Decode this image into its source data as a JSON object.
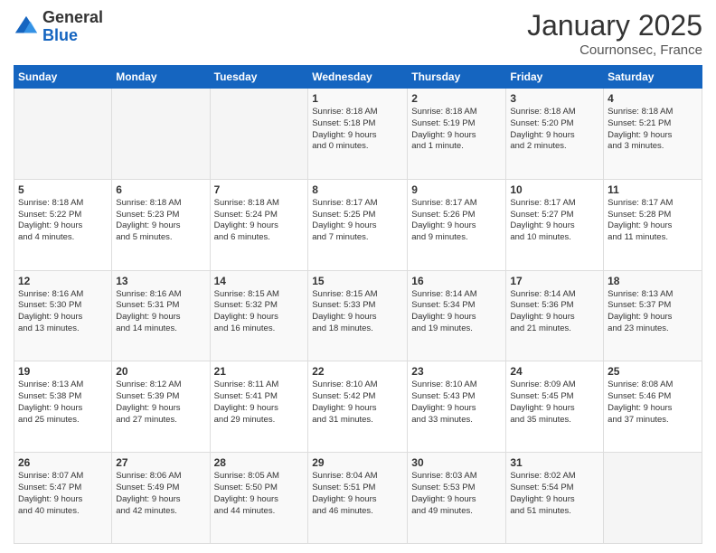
{
  "logo": {
    "general": "General",
    "blue": "Blue"
  },
  "header": {
    "month": "January 2025",
    "location": "Cournonsec, France"
  },
  "weekdays": [
    "Sunday",
    "Monday",
    "Tuesday",
    "Wednesday",
    "Thursday",
    "Friday",
    "Saturday"
  ],
  "weeks": [
    [
      {
        "day": "",
        "info": ""
      },
      {
        "day": "",
        "info": ""
      },
      {
        "day": "",
        "info": ""
      },
      {
        "day": "1",
        "info": "Sunrise: 8:18 AM\nSunset: 5:18 PM\nDaylight: 9 hours\nand 0 minutes."
      },
      {
        "day": "2",
        "info": "Sunrise: 8:18 AM\nSunset: 5:19 PM\nDaylight: 9 hours\nand 1 minute."
      },
      {
        "day": "3",
        "info": "Sunrise: 8:18 AM\nSunset: 5:20 PM\nDaylight: 9 hours\nand 2 minutes."
      },
      {
        "day": "4",
        "info": "Sunrise: 8:18 AM\nSunset: 5:21 PM\nDaylight: 9 hours\nand 3 minutes."
      }
    ],
    [
      {
        "day": "5",
        "info": "Sunrise: 8:18 AM\nSunset: 5:22 PM\nDaylight: 9 hours\nand 4 minutes."
      },
      {
        "day": "6",
        "info": "Sunrise: 8:18 AM\nSunset: 5:23 PM\nDaylight: 9 hours\nand 5 minutes."
      },
      {
        "day": "7",
        "info": "Sunrise: 8:18 AM\nSunset: 5:24 PM\nDaylight: 9 hours\nand 6 minutes."
      },
      {
        "day": "8",
        "info": "Sunrise: 8:17 AM\nSunset: 5:25 PM\nDaylight: 9 hours\nand 7 minutes."
      },
      {
        "day": "9",
        "info": "Sunrise: 8:17 AM\nSunset: 5:26 PM\nDaylight: 9 hours\nand 9 minutes."
      },
      {
        "day": "10",
        "info": "Sunrise: 8:17 AM\nSunset: 5:27 PM\nDaylight: 9 hours\nand 10 minutes."
      },
      {
        "day": "11",
        "info": "Sunrise: 8:17 AM\nSunset: 5:28 PM\nDaylight: 9 hours\nand 11 minutes."
      }
    ],
    [
      {
        "day": "12",
        "info": "Sunrise: 8:16 AM\nSunset: 5:30 PM\nDaylight: 9 hours\nand 13 minutes."
      },
      {
        "day": "13",
        "info": "Sunrise: 8:16 AM\nSunset: 5:31 PM\nDaylight: 9 hours\nand 14 minutes."
      },
      {
        "day": "14",
        "info": "Sunrise: 8:15 AM\nSunset: 5:32 PM\nDaylight: 9 hours\nand 16 minutes."
      },
      {
        "day": "15",
        "info": "Sunrise: 8:15 AM\nSunset: 5:33 PM\nDaylight: 9 hours\nand 18 minutes."
      },
      {
        "day": "16",
        "info": "Sunrise: 8:14 AM\nSunset: 5:34 PM\nDaylight: 9 hours\nand 19 minutes."
      },
      {
        "day": "17",
        "info": "Sunrise: 8:14 AM\nSunset: 5:36 PM\nDaylight: 9 hours\nand 21 minutes."
      },
      {
        "day": "18",
        "info": "Sunrise: 8:13 AM\nSunset: 5:37 PM\nDaylight: 9 hours\nand 23 minutes."
      }
    ],
    [
      {
        "day": "19",
        "info": "Sunrise: 8:13 AM\nSunset: 5:38 PM\nDaylight: 9 hours\nand 25 minutes."
      },
      {
        "day": "20",
        "info": "Sunrise: 8:12 AM\nSunset: 5:39 PM\nDaylight: 9 hours\nand 27 minutes."
      },
      {
        "day": "21",
        "info": "Sunrise: 8:11 AM\nSunset: 5:41 PM\nDaylight: 9 hours\nand 29 minutes."
      },
      {
        "day": "22",
        "info": "Sunrise: 8:10 AM\nSunset: 5:42 PM\nDaylight: 9 hours\nand 31 minutes."
      },
      {
        "day": "23",
        "info": "Sunrise: 8:10 AM\nSunset: 5:43 PM\nDaylight: 9 hours\nand 33 minutes."
      },
      {
        "day": "24",
        "info": "Sunrise: 8:09 AM\nSunset: 5:45 PM\nDaylight: 9 hours\nand 35 minutes."
      },
      {
        "day": "25",
        "info": "Sunrise: 8:08 AM\nSunset: 5:46 PM\nDaylight: 9 hours\nand 37 minutes."
      }
    ],
    [
      {
        "day": "26",
        "info": "Sunrise: 8:07 AM\nSunset: 5:47 PM\nDaylight: 9 hours\nand 40 minutes."
      },
      {
        "day": "27",
        "info": "Sunrise: 8:06 AM\nSunset: 5:49 PM\nDaylight: 9 hours\nand 42 minutes."
      },
      {
        "day": "28",
        "info": "Sunrise: 8:05 AM\nSunset: 5:50 PM\nDaylight: 9 hours\nand 44 minutes."
      },
      {
        "day": "29",
        "info": "Sunrise: 8:04 AM\nSunset: 5:51 PM\nDaylight: 9 hours\nand 46 minutes."
      },
      {
        "day": "30",
        "info": "Sunrise: 8:03 AM\nSunset: 5:53 PM\nDaylight: 9 hours\nand 49 minutes."
      },
      {
        "day": "31",
        "info": "Sunrise: 8:02 AM\nSunset: 5:54 PM\nDaylight: 9 hours\nand 51 minutes."
      },
      {
        "day": "",
        "info": ""
      }
    ]
  ]
}
